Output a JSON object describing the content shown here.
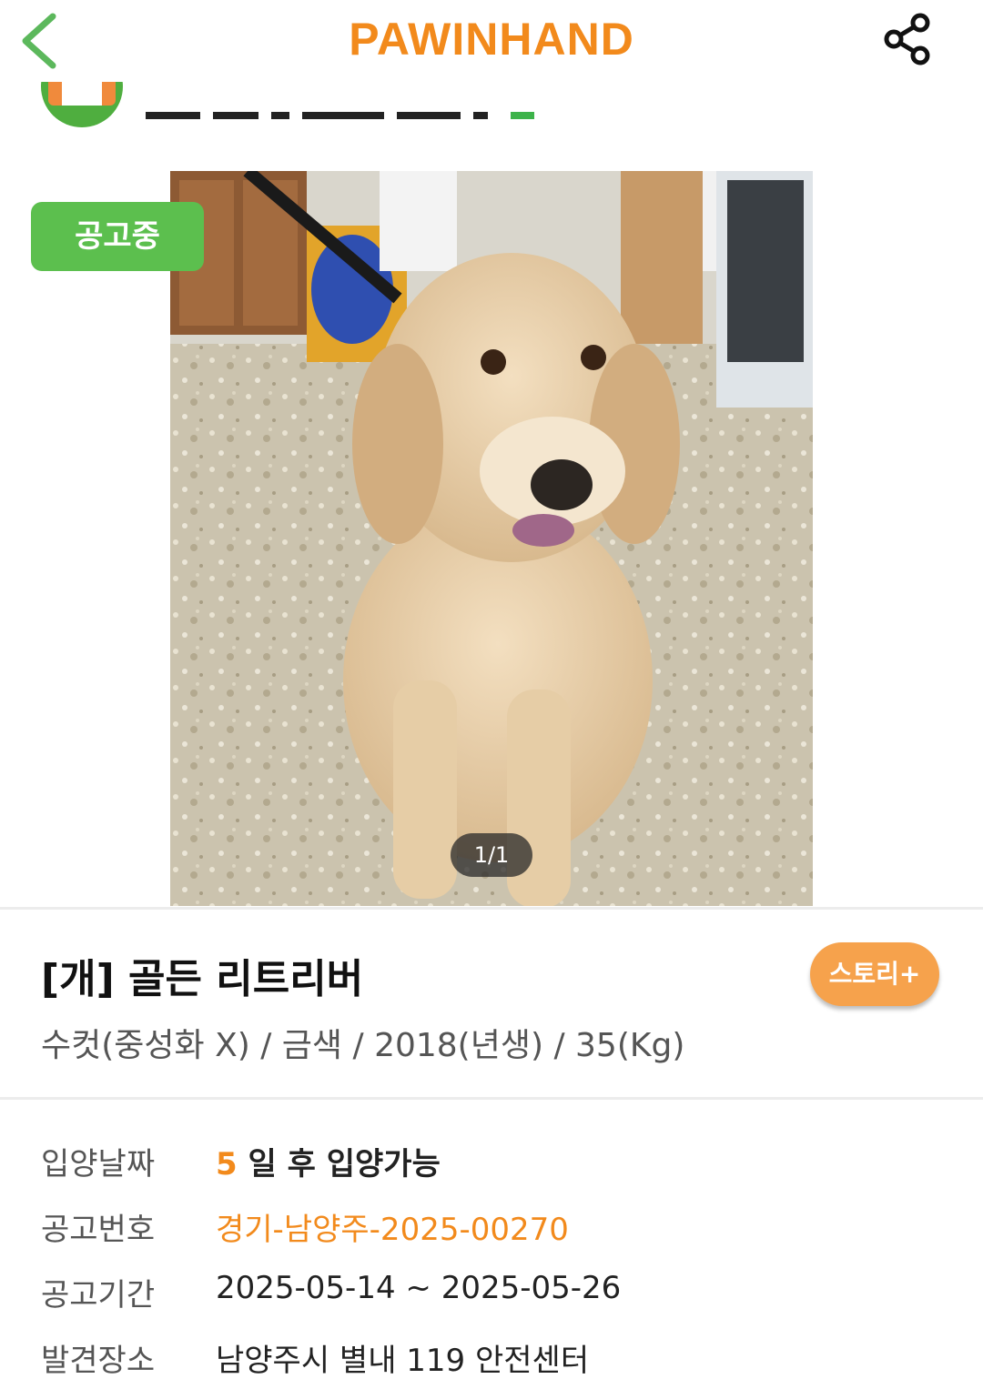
{
  "header": {
    "brand": "PAWINHAND",
    "brand_color": "#f28a1c",
    "back_icon": "chevron-left-icon",
    "share_icon": "share-icon"
  },
  "photo": {
    "status_badge": "공고중",
    "page_indicator": "1/1"
  },
  "pet": {
    "title": "[개] 골든 리트리버",
    "summary": "수컷(중성화 X) / 금색 / 2018(년생) / 35(Kg)",
    "story_button": "스토리+"
  },
  "info": {
    "adoption_date": {
      "label": "입양날짜",
      "days": "5",
      "text": " 일 후 입양가능"
    },
    "notice_number": {
      "label": "공고번호",
      "value": "경기-남양주-2025-00270"
    },
    "notice_period": {
      "label": "공고기간",
      "value": "2025-05-14 ~ 2025-05-26"
    },
    "found_location": {
      "label": "발견장소",
      "value": "남양주시 별내 119 안전센터"
    }
  },
  "colors": {
    "accent": "#f28a1c",
    "badge_green": "#5cbf4e",
    "story_orange": "#f6a24c"
  }
}
